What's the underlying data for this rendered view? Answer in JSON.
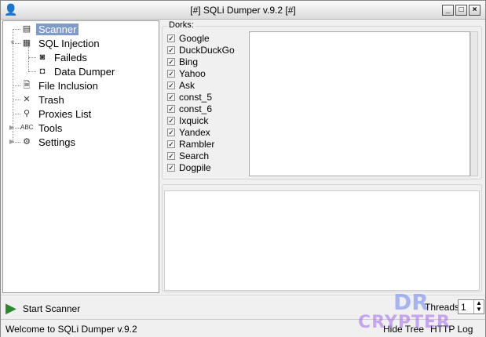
{
  "window": {
    "title": "[#] SQLi Dumper v.9.2 [#]",
    "minimize": "_",
    "maximize": "□",
    "close": "×"
  },
  "tree": {
    "items": [
      {
        "label": "Scanner",
        "icon": "scanner-icon"
      },
      {
        "label": "SQL Injection",
        "icon": "database-icon"
      },
      {
        "label": "Faileds",
        "icon": "failed-icon"
      },
      {
        "label": "Data Dumper",
        "icon": "dumper-icon"
      },
      {
        "label": "File Inclusion",
        "icon": "file-icon"
      },
      {
        "label": "Trash",
        "icon": "trash-icon"
      },
      {
        "label": "Proxies List",
        "icon": "network-icon"
      },
      {
        "label": "Tools",
        "icon": "tools-icon"
      },
      {
        "label": "Settings",
        "icon": "settings-icon"
      }
    ]
  },
  "dorks": {
    "label": "Dorks:",
    "engines": [
      "Google",
      "DuckDuckGo",
      "Bing",
      "Yahoo",
      "Ask",
      "const_5",
      "const_6",
      "Ixquick",
      "Yandex",
      "Rambler",
      "Search",
      "Dogpile"
    ]
  },
  "bottom": {
    "start_label": "Start Scanner",
    "threads_label": "Threads",
    "threads_value": "1"
  },
  "status": {
    "text": "Welcome to SQLi Dumper v.9.2",
    "hide_tree": "Hide Tree",
    "http_log": "HTTP Log"
  },
  "watermark": {
    "line1": "DR",
    "line2": "CRYPTER"
  }
}
